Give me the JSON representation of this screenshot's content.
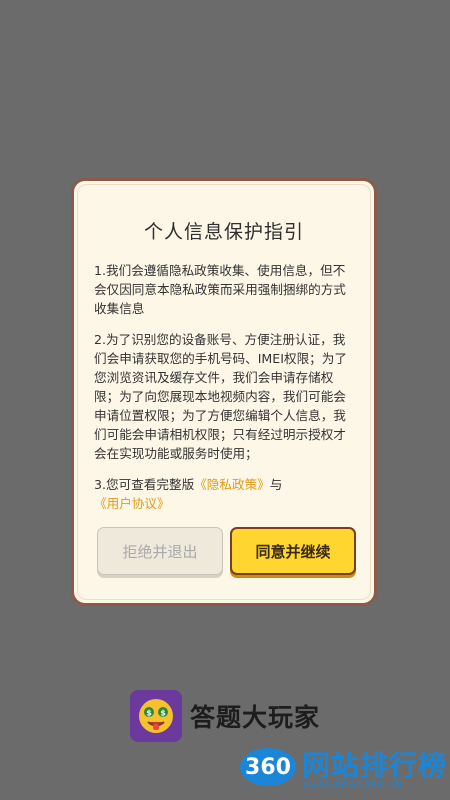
{
  "dialog": {
    "title": "个人信息保护指引",
    "para1": "1.我们会遵循隐私政策收集、使用信息，但不会仅因同意本隐私政策而采用强制捆绑的方式收集信息",
    "para2": "2.为了识别您的设备账号、方便注册认证，我们会申请获取您的手机号码、IMEI权限；为了您浏览资讯及缓存文件，我们会申请存储权限；为了向您展现本地视频内容，我们可能会申请位置权限；为了方便您编辑个人信息，我们可能会申请相机权限；只有经过明示授权才会在实现功能或服务时使用；",
    "para3_prefix": "3.您可查看完整版",
    "privacy_link": "《隐私政策》",
    "and_text": "与",
    "agreement_link": "《用户协议》",
    "reject_label": "拒绝并退出",
    "agree_label": "同意并继续"
  },
  "brand": {
    "name": "答题大玩家",
    "logo_icon": "money-eyes-emoji-icon"
  },
  "watermark": {
    "badge": "360",
    "text": "网站排行榜",
    "sub": "WANGZHAN360.CN"
  },
  "colors": {
    "overlay": "#6b6b6b",
    "dialog_bg": "#fdf7e8",
    "dialog_border": "#8c5a4a",
    "link": "#e29a18",
    "agree_button": "#ffd52f"
  }
}
